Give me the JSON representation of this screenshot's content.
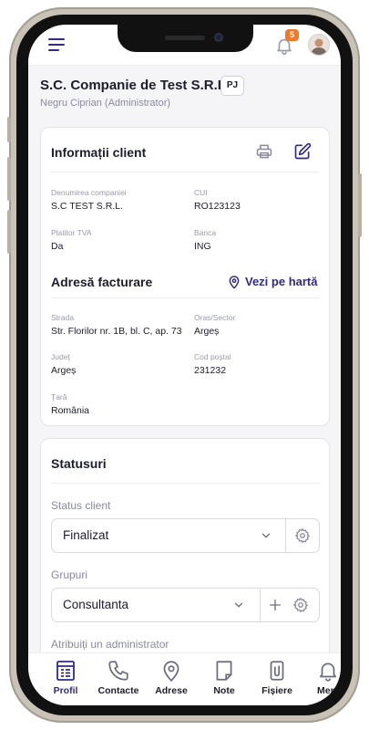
{
  "notifications": {
    "count": "5"
  },
  "company": {
    "name": "S.C. Companie de Test S.R.L.",
    "type_badge": "PJ",
    "owner": "Negru Ciprian (Administrator)"
  },
  "client_info": {
    "title": "Informații client",
    "fields": [
      {
        "label": "Denumirea companiei",
        "value": "S.C TEST S.R.L."
      },
      {
        "label": "CUI",
        "value": "RO123123"
      },
      {
        "label": "Platitor TVA",
        "value": "Da"
      },
      {
        "label": "Banca",
        "value": "ING"
      }
    ]
  },
  "billing_address": {
    "title": "Adresă facturare",
    "map_link": "Vezi pe hartă",
    "fields": [
      {
        "label": "Strada",
        "value": "Str. Florilor nr. 1B, bl. C, ap. 73"
      },
      {
        "label": "Oras/Sector",
        "value": "Argeș"
      },
      {
        "label": "Judeţ",
        "value": "Argeș"
      },
      {
        "label": "Cod poștal",
        "value": "231232"
      },
      {
        "label": "Ţară",
        "value": "România"
      }
    ]
  },
  "statuses": {
    "title": "Statusuri",
    "status_label": "Status client",
    "status_value": "Finalizat",
    "groups_label": "Grupuri",
    "groups_value": "Consultanta",
    "admin_label": "Atribuiți un administrator"
  },
  "tabs": [
    {
      "label": "Profil",
      "icon": "profile-icon",
      "active": true
    },
    {
      "label": "Contacte",
      "icon": "phone-icon"
    },
    {
      "label": "Adrese",
      "icon": "location-pin-icon"
    },
    {
      "label": "Note",
      "icon": "note-icon"
    },
    {
      "label": "Fișiere",
      "icon": "paperclip-icon"
    },
    {
      "label": "Mem",
      "icon": "bell-icon"
    }
  ],
  "colors": {
    "accent": "#2f2a8a",
    "badge": "#f07a2a",
    "background": "#f5f5f8"
  }
}
